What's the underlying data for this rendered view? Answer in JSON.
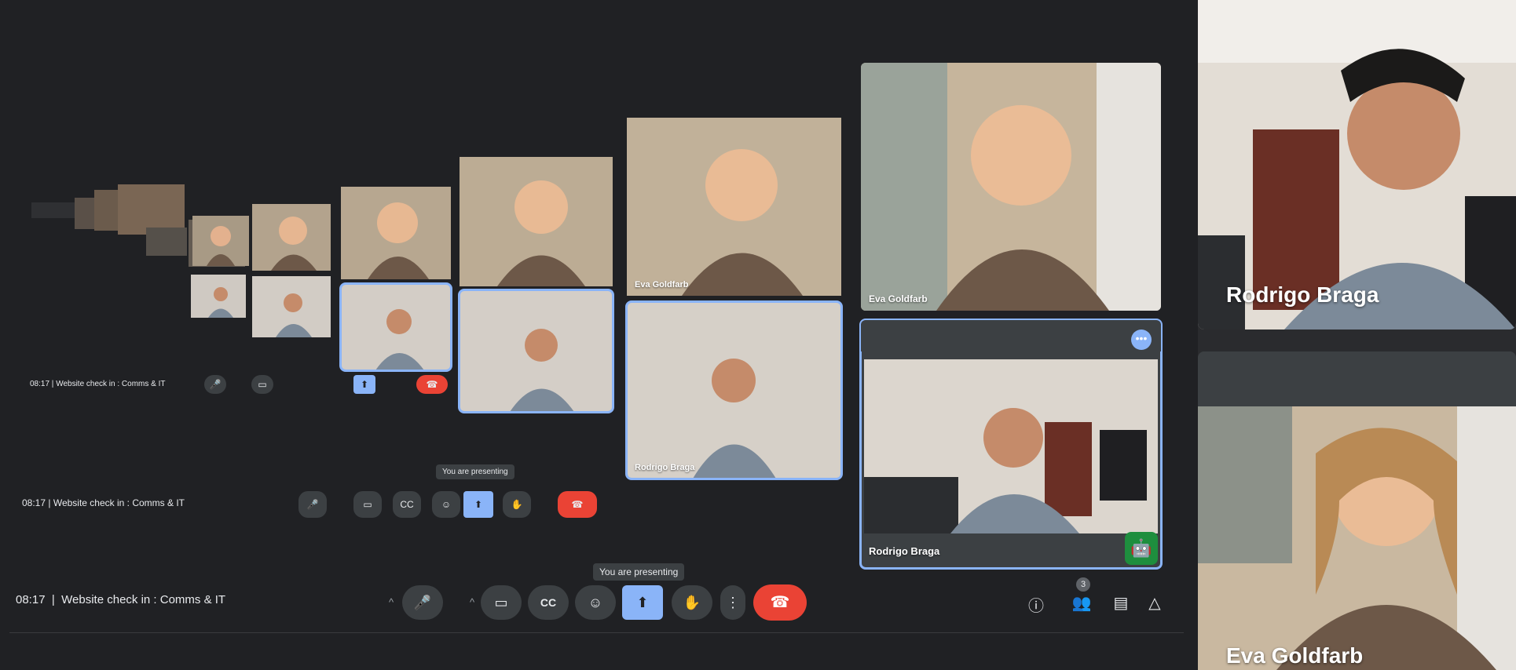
{
  "meeting": {
    "time": "08:17",
    "separator": "|",
    "title": "Website check in : Comms & IT",
    "presenting_tooltip": "You are presenting",
    "participant_count": "3"
  },
  "participants": [
    {
      "name": "Eva Goldfarb"
    },
    {
      "name": "Rodrigo Braga"
    }
  ],
  "controls": {
    "chevron": "^",
    "mic": "🎤",
    "camera": "▭",
    "captions": "CC",
    "emoji": "☺",
    "present": "⬆",
    "raise_hand": "✋",
    "more": "⋮",
    "end_call": "☎"
  },
  "right_controls": {
    "info": "ⓘ",
    "people": "👥",
    "chat": "▤",
    "activities": "△"
  },
  "tile_menu": "•••",
  "colors": {
    "background": "#202124",
    "button": "#3c4043",
    "present_active": "#8ab4f8",
    "end_call": "#ea4335",
    "speaking_outline": "#8ab4f8",
    "badge_green": "#1e8e3e"
  }
}
